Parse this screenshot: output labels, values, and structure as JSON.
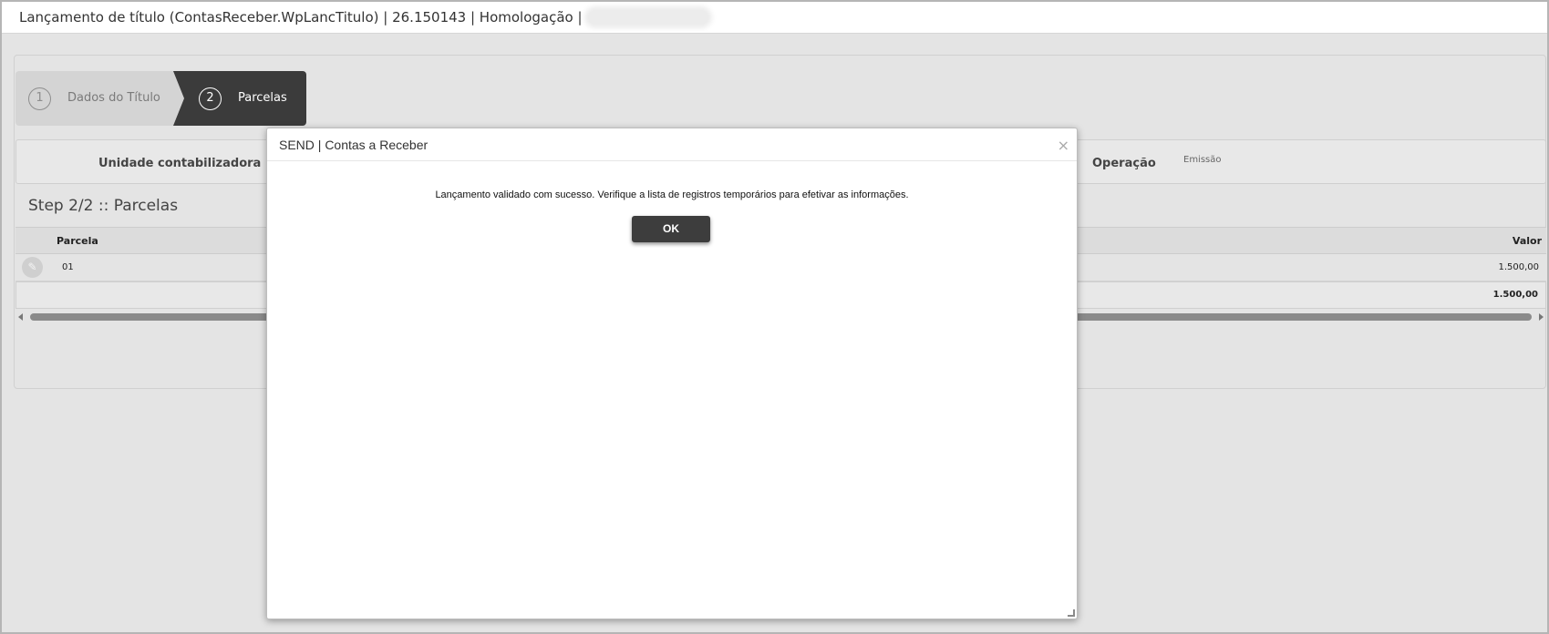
{
  "window": {
    "title": "Lançamento de título (ContasReceber.WpLancTitulo) | 26.150143 | Homologação |"
  },
  "stepper": {
    "steps": [
      {
        "number": "1",
        "label": "Dados do Título"
      },
      {
        "number": "2",
        "label": "Parcelas"
      }
    ]
  },
  "info": {
    "unidade_label": "Unidade contabilizadora",
    "operacao_label": "Operação",
    "operacao_value": "Emissão"
  },
  "step_title": "Step 2/2 :: Parcelas",
  "grid": {
    "columns": [
      "Parcela",
      "Valor"
    ],
    "rows": [
      {
        "parcela": "01",
        "valor": "1.500,00"
      }
    ],
    "total": "1.500,00"
  },
  "modal": {
    "title": "SEND | Contas a Receber",
    "message": "Lançamento validado com sucesso. Verifique a lista de registros temporários para efetivar as informações.",
    "ok_label": "OK",
    "close_glyph": "×"
  },
  "icons": {
    "edit": "pencil-icon",
    "close": "close-icon"
  }
}
